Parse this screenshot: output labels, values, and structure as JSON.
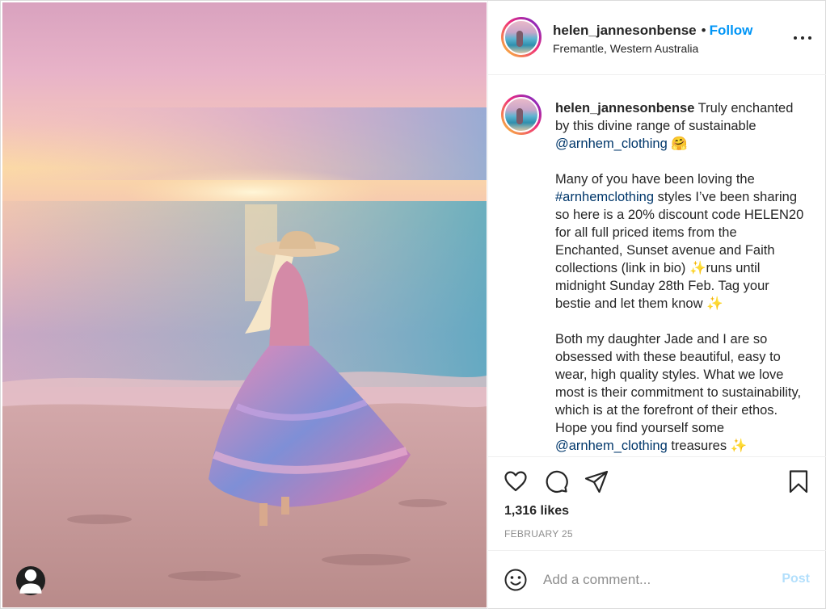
{
  "header": {
    "username": "helen_jannesonbense",
    "separator": "•",
    "follow_label": "Follow",
    "location": "Fremantle, Western Australia",
    "more_icon": "more-horizontal-icon"
  },
  "caption": {
    "username": "helen_jannesonbense",
    "part1": " Truly enchanted by this divine range of sustainable ",
    "mention1": "@arnhem_clothing",
    "emoji1": " 🤗\n\nMany of you have been loving the ",
    "hashtag": "#arnhemclothing",
    "part2": " styles I’ve been sharing so here is a 20% discount code HELEN20 for all full priced items from the Enchanted, Sunset avenue and Faith collections (link in bio) ✨runs until midnight Sunday 28th Feb. Tag your bestie and let them know ✨\n\nBoth my daughter Jade and I are so obsessed with these beautiful, easy to wear, high quality styles. What we love most is their commitment to sustainability, which is at the forefront of their ethos. Hope you find yourself some ",
    "mention2": "@arnhem_clothing",
    "part3": " treasures ✨"
  },
  "actions": {
    "like_icon": "heart-icon",
    "comment_icon": "comment-icon",
    "share_icon": "paper-plane-icon",
    "save_icon": "bookmark-icon",
    "likes": "1,316 likes",
    "date": "FEBRUARY 25"
  },
  "comment": {
    "emoji_icon": "smiley-icon",
    "placeholder": "Add a comment...",
    "post_label": "Post"
  },
  "colors": {
    "accent": "#0095f6",
    "post_disabled": "#b2dffc",
    "link": "#00376b",
    "muted": "#8e8e8e"
  }
}
